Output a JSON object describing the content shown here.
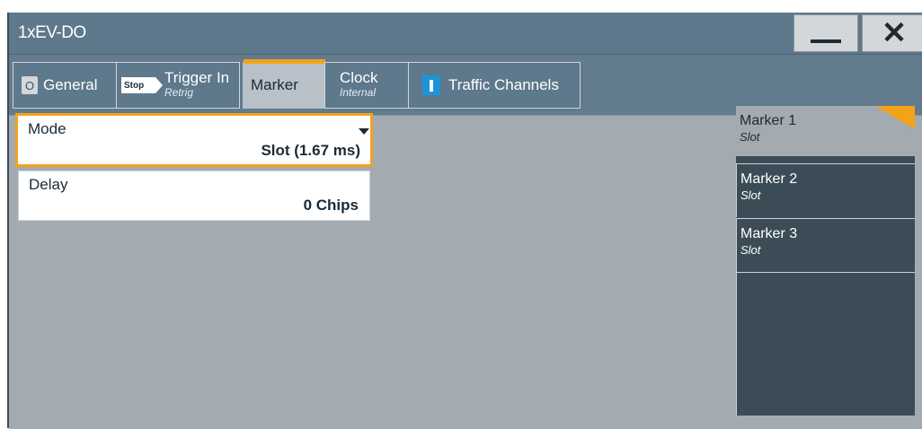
{
  "window": {
    "title": "1xEV-DO",
    "minimize_icon": "minimize-icon",
    "close_icon": "close-icon"
  },
  "tabs": [
    {
      "label": "General",
      "badge": "O"
    },
    {
      "label": "Trigger In",
      "sub": "Retrig",
      "badge": "Stop"
    },
    {
      "label": "Marker",
      "active": true
    },
    {
      "label": "Clock",
      "sub": "Internal"
    },
    {
      "label": "Traffic Channels",
      "badge_icon": "channel-indicator-icon"
    }
  ],
  "marker_settings": {
    "mode": {
      "label": "Mode",
      "value": "Slot (1.67 ms)"
    },
    "delay": {
      "label": "Delay",
      "value": "0 Chips"
    }
  },
  "side_panel": [
    {
      "name": "Marker 1",
      "sub": "Slot",
      "selected": true
    },
    {
      "name": "Marker 2",
      "sub": "Slot"
    },
    {
      "name": "Marker 3",
      "sub": "Slot"
    }
  ],
  "colors": {
    "accent": "#f5a21b",
    "titlebar": "#5e788c",
    "panel_bg": "#a3aab0",
    "side_dark": "#3b4c57",
    "badge_blue": "#1c95d8"
  }
}
